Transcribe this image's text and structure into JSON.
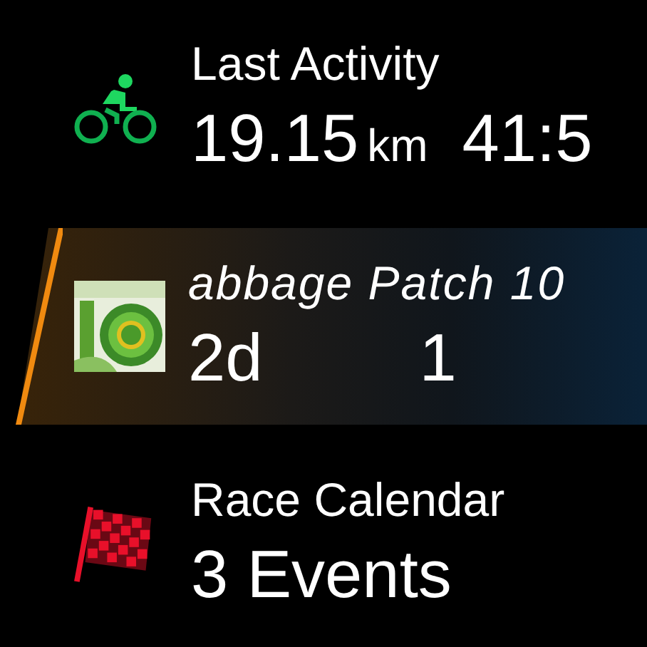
{
  "glances": [
    {
      "kind": "activity",
      "title": "Last Activity",
      "value": "19.15",
      "unit": "km",
      "value_2": "41:5",
      "selected": false
    },
    {
      "kind": "event",
      "title": "abbage Patch 10",
      "value": "2d",
      "value_2": "1",
      "selected": true
    },
    {
      "kind": "calendar",
      "title": "Race Calendar",
      "value": "3 Events",
      "selected": false
    }
  ]
}
